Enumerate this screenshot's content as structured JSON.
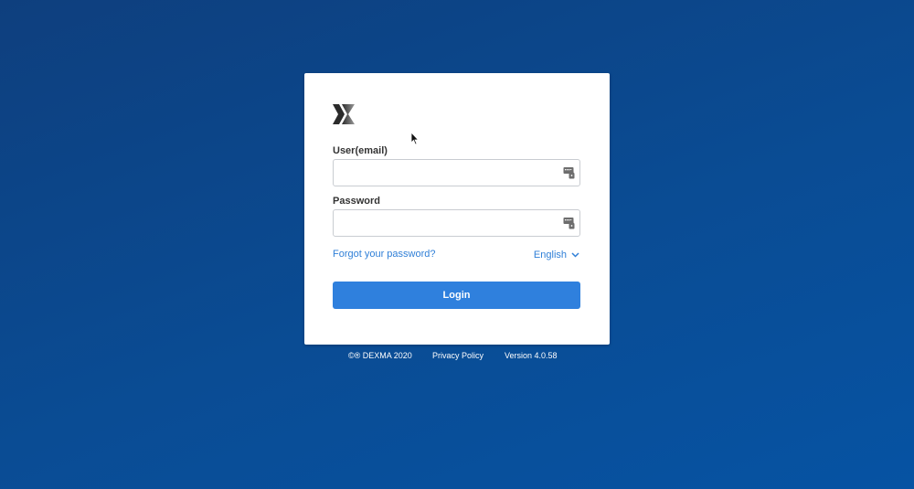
{
  "brand": {
    "logo_icon": "dexma-x-logo-icon"
  },
  "form": {
    "user_label": "User(email)",
    "user_value": "",
    "password_label": "Password",
    "password_value": "",
    "field_icon": "password-manager-key-icon",
    "forgot_link": "Forgot your password?",
    "language": "English",
    "language_icon": "chevron-down-icon",
    "login_button": "Login"
  },
  "footer": {
    "copyright": "©® DEXMA 2020",
    "privacy": "Privacy Policy",
    "version": "Version 4.0.58"
  },
  "colors": {
    "background_start": "#0e3f7e",
    "background_end": "#0653a3",
    "accent": "#2f80dd",
    "link": "#2f7fd7"
  }
}
